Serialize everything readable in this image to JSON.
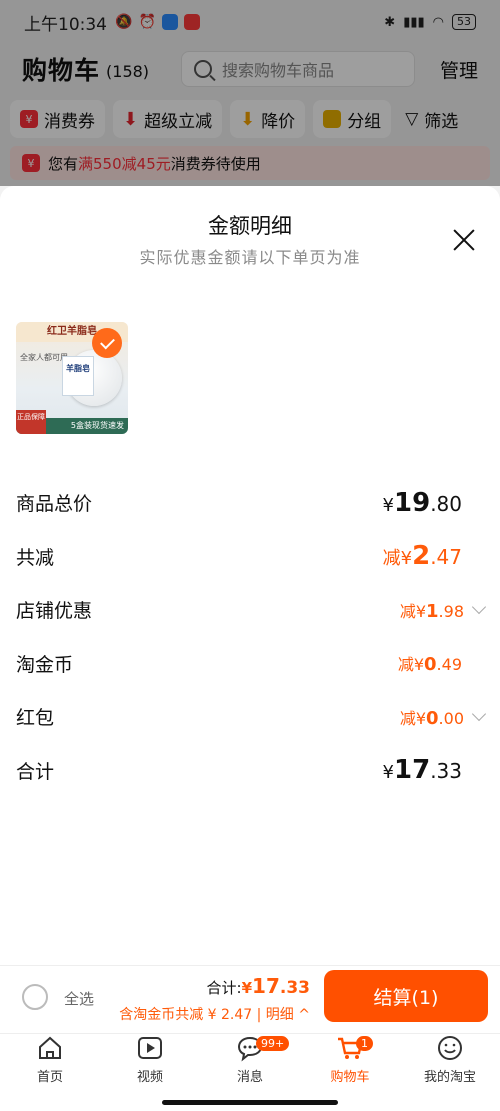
{
  "status": {
    "time": "上午10:34",
    "battery": "53"
  },
  "header": {
    "title": "购物车",
    "count": "(158)",
    "search_placeholder": "搜索购物车商品",
    "manage": "管理"
  },
  "chips": [
    {
      "label": "消费券",
      "icon": "coupon-icon",
      "color": "#ff2f3a"
    },
    {
      "label": "超级立减",
      "icon": "arrow-down-icon",
      "color": "#e5262f"
    },
    {
      "label": "降价",
      "icon": "price-drop-icon",
      "color": "#f5a400"
    },
    {
      "label": "分组",
      "icon": "folder-icon",
      "color": "#e8b100"
    },
    {
      "label": "筛选",
      "icon": "filter-icon",
      "color": "#333333"
    }
  ],
  "coupon_bar": {
    "pre": "您有",
    "highlight": "满550减45元",
    "post": "消费券待使用"
  },
  "sheet": {
    "title": "金额明细",
    "subtitle": "实际优惠金额请以下单页为准",
    "product": {
      "top_text": "红卫羊脂皂",
      "side_text": "全家人都可用",
      "box_text": "羊脂皂",
      "badge": "正品保障",
      "foot": "5盒装现货速发"
    },
    "rows": [
      {
        "label": "商品总价",
        "prefix": "¥",
        "int": "19",
        "dec": ".80",
        "style": "black-big"
      },
      {
        "label": "共减",
        "prefix": "减¥",
        "int": "2",
        "dec": ".47",
        "style": "orange-big"
      },
      {
        "label": "店铺优惠",
        "prefix": "减¥",
        "int": "1",
        "dec": ".98",
        "style": "orange-small",
        "chevron": true
      },
      {
        "label": "淘金币",
        "prefix": "减¥",
        "int": "0",
        "dec": ".49",
        "style": "orange-small"
      },
      {
        "label": "红包",
        "prefix": "减¥",
        "int": "0",
        "dec": ".00",
        "style": "orange-small",
        "chevron": true
      },
      {
        "label": "合计",
        "prefix": "¥",
        "int": "17",
        "dec": ".33",
        "style": "black-big"
      }
    ]
  },
  "checkout": {
    "select_all": "全选",
    "total_label": "合计:",
    "total_currency": "¥",
    "total_int": "17",
    "total_dec": ".33",
    "note": "含淘金币共减 ¥ 2.47 | 明细",
    "pay_button": "结算(1)"
  },
  "tabs": [
    {
      "label": "首页",
      "icon": "home-icon"
    },
    {
      "label": "视频",
      "icon": "video-icon"
    },
    {
      "label": "消息",
      "icon": "message-icon",
      "badge": "99+"
    },
    {
      "label": "购物车",
      "icon": "cart-icon",
      "badge": "1",
      "active": true
    },
    {
      "label": "我的淘宝",
      "icon": "profile-icon"
    }
  ]
}
